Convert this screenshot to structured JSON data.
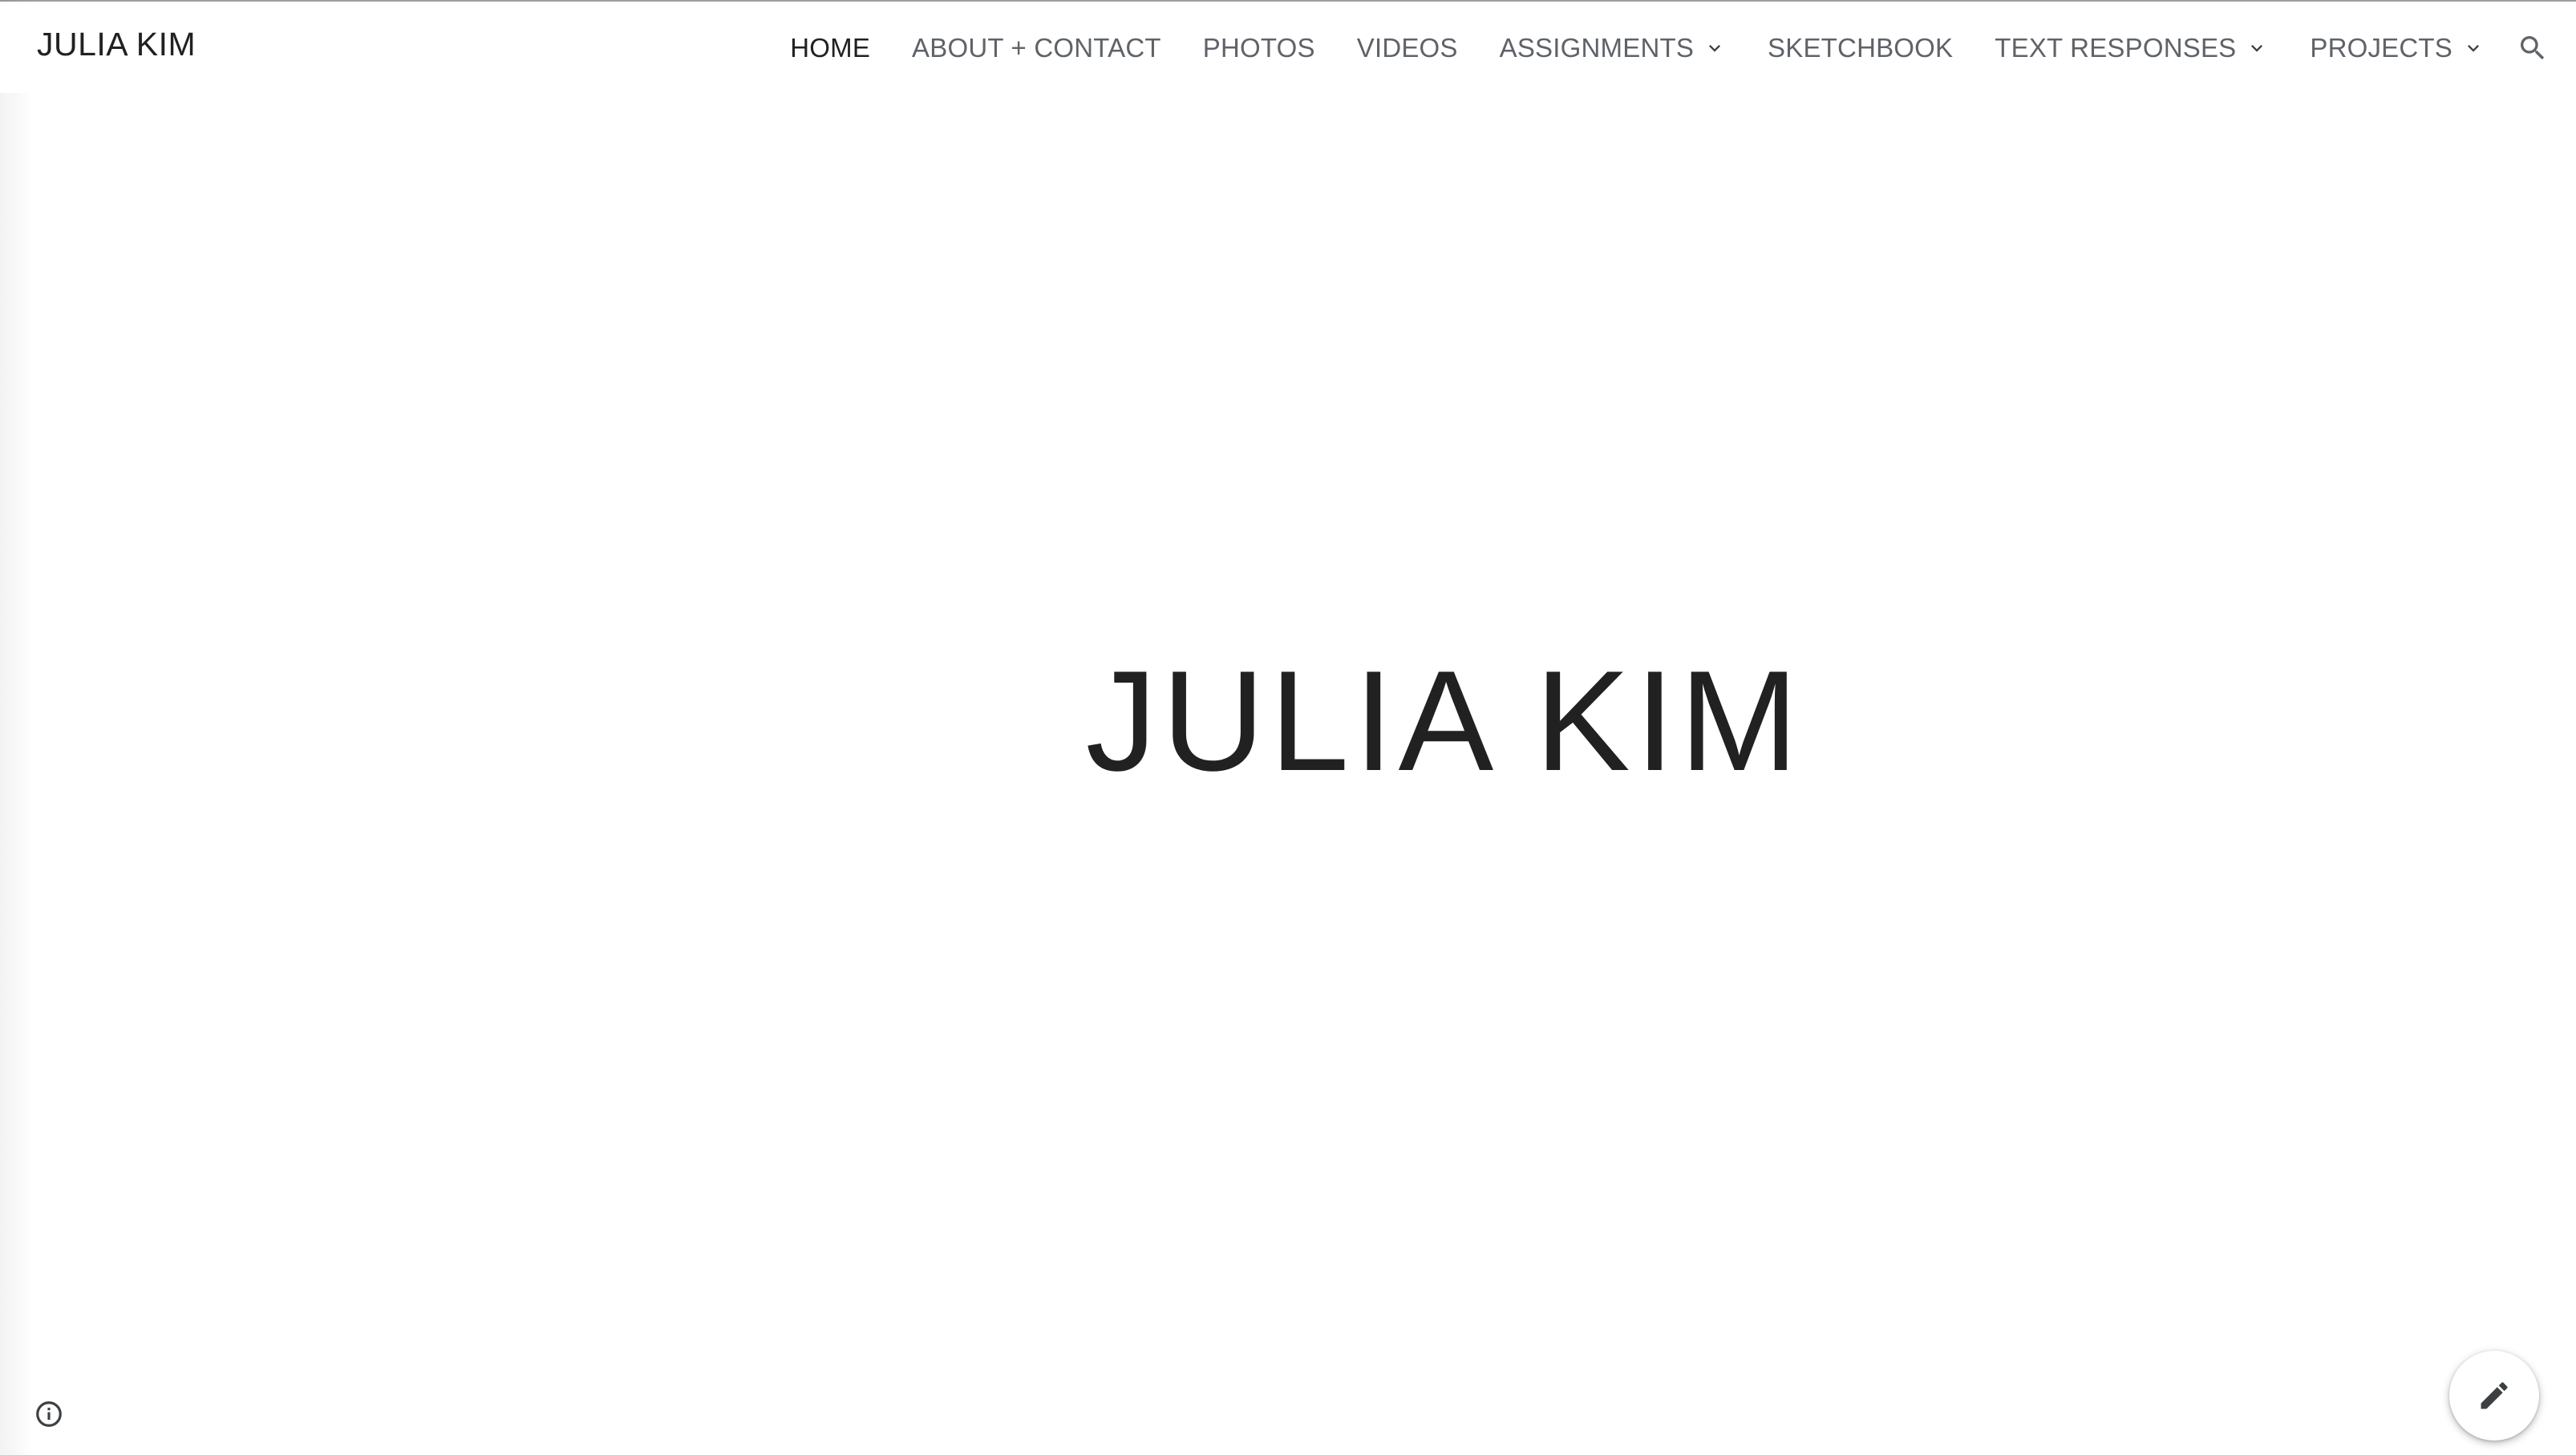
{
  "site": {
    "title": "JULIA KIM"
  },
  "nav": {
    "items": [
      {
        "label": "HOME",
        "active": true,
        "has_dropdown": false
      },
      {
        "label": "ABOUT + CONTACT",
        "active": false,
        "has_dropdown": false
      },
      {
        "label": "PHOTOS",
        "active": false,
        "has_dropdown": false
      },
      {
        "label": "VIDEOS",
        "active": false,
        "has_dropdown": false
      },
      {
        "label": "ASSIGNMENTS",
        "active": false,
        "has_dropdown": true
      },
      {
        "label": "SKETCHBOOK",
        "active": false,
        "has_dropdown": false
      },
      {
        "label": "TEXT RESPONSES",
        "active": false,
        "has_dropdown": true
      },
      {
        "label": "PROJECTS",
        "active": false,
        "has_dropdown": true
      }
    ],
    "search_icon": "search-icon",
    "dropdown_icon": "chevron-down-icon"
  },
  "hero": {
    "title": "JULIA KIM"
  },
  "footer": {
    "info_icon": "info-icon",
    "edit_icon": "pencil-icon"
  },
  "colors": {
    "text_primary": "#212121",
    "text_nav": "#5f6368",
    "background": "#ffffff",
    "top_border": "#9e9e9e"
  }
}
